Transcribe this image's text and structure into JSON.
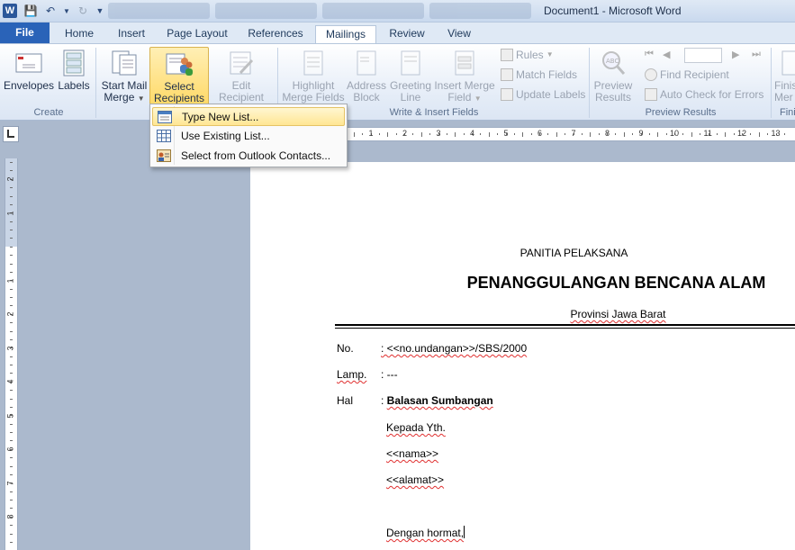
{
  "window": {
    "title": "Document1  -  Microsoft Word",
    "app_icon": "W"
  },
  "tabs": [
    {
      "label": "File"
    },
    {
      "label": "Home"
    },
    {
      "label": "Insert"
    },
    {
      "label": "Page Layout"
    },
    {
      "label": "References"
    },
    {
      "label": "Mailings"
    },
    {
      "label": "Review"
    },
    {
      "label": "View"
    }
  ],
  "active_tab": "Mailings",
  "ribbon": {
    "create": {
      "label": "Create",
      "envelopes": "Envelopes",
      "labels": "Labels"
    },
    "start_mail_merge": {
      "line1": "Start Mail",
      "line2": "Merge"
    },
    "select_recipients": {
      "line1": "Select",
      "line2": "Recipients"
    },
    "edit_recipient_list": {
      "line1": "Edit",
      "line2": "Recipient List"
    },
    "write_insert": {
      "label": "Write & Insert Fields",
      "highlight": {
        "line1": "Highlight",
        "line2": "Merge Fields"
      },
      "address": {
        "line1": "Address",
        "line2": "Block"
      },
      "greeting": {
        "line1": "Greeting",
        "line2": "Line"
      },
      "insert_merge": {
        "line1": "Insert Merge",
        "line2": "Field"
      },
      "rules": "Rules",
      "match_fields": "Match Fields",
      "update_labels": "Update Labels"
    },
    "preview": {
      "label": "Preview Results",
      "preview_btn": {
        "line1": "Preview",
        "line2": "Results"
      },
      "find_recipient": "Find Recipient",
      "auto_check": "Auto Check for Errors"
    },
    "finish": {
      "label": "Fini",
      "line1": "Finis",
      "line2": "Mer"
    }
  },
  "dropdown": {
    "items": [
      {
        "label": "Type New List..."
      },
      {
        "label": "Use Existing List..."
      },
      {
        "label": "Select from Outlook Contacts..."
      }
    ],
    "highlighted_index": 0
  },
  "ruler": {
    "h_numbers": [
      "1",
      "2",
      "3",
      "4",
      "5",
      "6",
      "7",
      "8",
      "9",
      "10",
      "11",
      "12",
      "13"
    ],
    "v_numbers": [
      "2",
      "1",
      "1",
      "2",
      "3",
      "4",
      "5",
      "6",
      "7",
      "8"
    ]
  },
  "document": {
    "org": "PANITIA PELAKSANA",
    "title": "PENANGGULANGAN BENCANA ALAM",
    "province": "Provinsi Jawa Barat",
    "no_label": "No.",
    "no_value": ": <<no.undangan>>/SBS/2000",
    "lamp_label": "Lamp.",
    "lamp_value": ": ---",
    "hal_label": "Hal",
    "hal_colon": ": ",
    "hal_value": "Balasan Sumbangan",
    "kepada": "Kepada Yth.",
    "nama": "<<nama>>",
    "alamat": "<<alamat>>",
    "salam": "Dengan hormat,"
  }
}
